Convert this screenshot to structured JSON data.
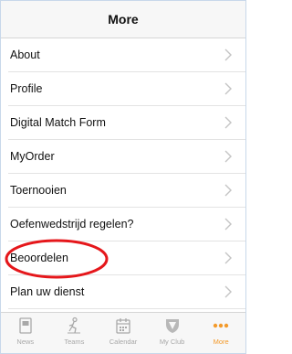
{
  "header": {
    "title": "More"
  },
  "menu": {
    "items": [
      {
        "label": "About"
      },
      {
        "label": "Profile"
      },
      {
        "label": "Digital Match Form"
      },
      {
        "label": "MyOrder"
      },
      {
        "label": "Toernooien"
      },
      {
        "label": "Oefenwedstrijd regelen?"
      },
      {
        "label": "Beoordelen"
      },
      {
        "label": "Plan uw dienst"
      }
    ],
    "highlighted_item": "Beoordelen",
    "highlight_color": "#e5171b"
  },
  "tabbar": {
    "active_color": "#f39a2b",
    "inactive_color": "#a8a8a8",
    "tabs": [
      {
        "label": "News",
        "icon": "news-icon"
      },
      {
        "label": "Teams",
        "icon": "teams-icon"
      },
      {
        "label": "Calendar",
        "icon": "calendar-icon"
      },
      {
        "label": "My Club",
        "icon": "club-shield-icon"
      },
      {
        "label": "More",
        "icon": "more-dots-icon"
      }
    ]
  }
}
